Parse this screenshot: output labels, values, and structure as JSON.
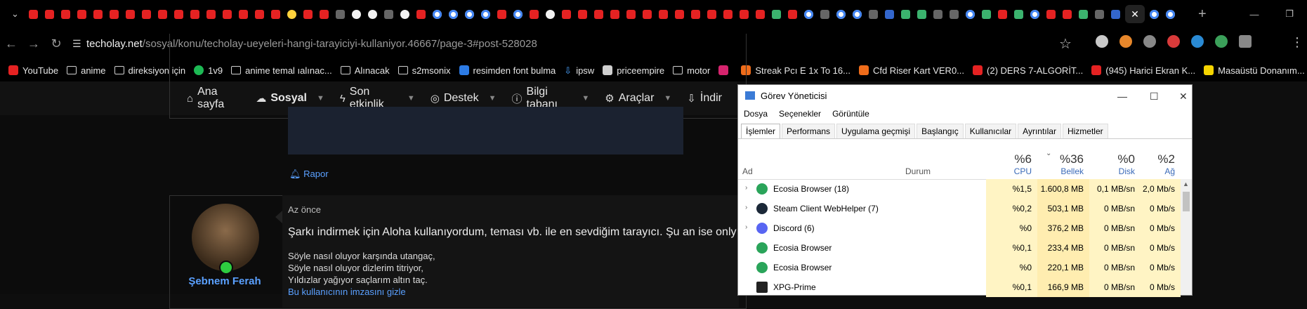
{
  "tabs": {
    "favicons": [
      "yt",
      "yt",
      "yt",
      "yt",
      "yt",
      "yt",
      "yt",
      "yt",
      "yt",
      "yt",
      "yt",
      "yt",
      "yt",
      "yt",
      "yt",
      "yt",
      "ok",
      "yt",
      "yt",
      "tc",
      "gh",
      "gh",
      "tc",
      "gh",
      "yt",
      "g",
      "g",
      "g",
      "g",
      "yt",
      "g",
      "yt",
      "gh",
      "yt",
      "yt",
      "yt",
      "yt",
      "yt",
      "yt",
      "yt",
      "yt",
      "yt",
      "yt",
      "yt",
      "yt",
      "yt",
      "grn",
      "yt",
      "g",
      "tc",
      "g",
      "g",
      "tc",
      "bl",
      "grn",
      "grn",
      "tc",
      "tc",
      "g",
      "grn",
      "yt",
      "grn",
      "g",
      "yt",
      "yt",
      "grn",
      "tc",
      "bl",
      "active",
      "g",
      "g"
    ],
    "new_tab": "+"
  },
  "window": {
    "minimize": "—",
    "restore": "❐",
    "close": "✕"
  },
  "address_bar": {
    "host": "techolay.net",
    "path": "/sosyal/konu/techolay-ueyeleri-hangi-tarayiciyi-kullaniyor.46667/page-3#post-528028"
  },
  "bookmarks": [
    {
      "icon": "yt",
      "label": "YouTube"
    },
    {
      "icon": "folder",
      "label": "anime"
    },
    {
      "icon": "folder",
      "label": "direksiyon için"
    },
    {
      "icon": "sp",
      "label": "1v9"
    },
    {
      "icon": "folder",
      "label": "anime temal ıalınac..."
    },
    {
      "icon": "folder",
      "label": "Alınacak"
    },
    {
      "icon": "folder",
      "label": "s2msonix"
    },
    {
      "icon": "blue",
      "label": "resimden font bulma"
    },
    {
      "icon": "dl",
      "label": "ipsw"
    },
    {
      "icon": "pe",
      "label": "priceempire"
    },
    {
      "icon": "folder",
      "label": "motor"
    },
    {
      "icon": "ig",
      "label": ""
    },
    {
      "icon": "hb",
      "label": "Streak Pcı E 1x To 16..."
    },
    {
      "icon": "hb",
      "label": "Cfd Riser Kart VER0..."
    },
    {
      "icon": "yt",
      "label": "(2) DERS 7-ALGORİT..."
    },
    {
      "icon": "yt",
      "label": "(945) Harici Ekran K..."
    },
    {
      "icon": "s",
      "label": "Masaüstü Donanım..."
    }
  ],
  "forum_nav": [
    {
      "icon": "⌂",
      "label": "Ana sayfa",
      "bold": false,
      "caret": false
    },
    {
      "icon": "☁",
      "label": "Sosyal",
      "bold": true,
      "caret": true
    },
    {
      "icon": "ϟ",
      "label": "Son etkinlik",
      "bold": false,
      "caret": true
    },
    {
      "icon": "◎",
      "label": "Destek",
      "bold": false,
      "caret": true
    },
    {
      "icon": "ⓘ",
      "label": "Bilgi tabanı",
      "bold": false,
      "caret": true
    },
    {
      "icon": "⚙",
      "label": "Araçlar",
      "bold": false,
      "caret": true
    },
    {
      "icon": "⇩",
      "label": "İndir",
      "bold": false,
      "caret": false
    }
  ],
  "post1": {
    "report": "Rapor"
  },
  "post2": {
    "time": "Az önce",
    "text": "Şarkı indirmek için Aloha kullanıyordum, teması vb. ile en sevdiğim tarayıcı. Şu an ise only Chrom",
    "signature": [
      "Söyle nasıl oluyor karşında utangaç,",
      "Söyle nasıl oluyor dizlerim titriyor,",
      "Yıldızlar yağıyor saçlarım altın taç."
    ],
    "signature_link": "Bu kullanıcının imzasını gizle",
    "username": "Şebnem Ferah"
  },
  "task_manager": {
    "title": "Görev Yöneticisi",
    "menu": [
      "Dosya",
      "Seçenekler",
      "Görüntüle"
    ],
    "tabs": [
      "İşlemler",
      "Performans",
      "Uygulama geçmişi",
      "Başlangıç",
      "Kullanıcılar",
      "Ayrıntılar",
      "Hizmetler"
    ],
    "columns": {
      "name": "Ad",
      "status": "Durum",
      "cpu": {
        "pct": "%6",
        "label": "CPU"
      },
      "mem": {
        "pct": "%36",
        "label": "Bellek"
      },
      "disk": {
        "pct": "%0",
        "label": "Disk"
      },
      "net": {
        "pct": "%2",
        "label": "Ağ"
      }
    },
    "rows": [
      {
        "icon": "eco",
        "expand": true,
        "name": "Ecosia Browser (18)",
        "cpu": "%1,5",
        "mem": "1.600,8 MB",
        "disk": "0,1 MB/sn",
        "net": "2,0 Mb/s"
      },
      {
        "icon": "steam",
        "expand": true,
        "name": "Steam Client WebHelper (7)",
        "cpu": "%0,2",
        "mem": "503,1 MB",
        "disk": "0 MB/sn",
        "net": "0 Mb/s"
      },
      {
        "icon": "disc",
        "expand": true,
        "name": "Discord (6)",
        "cpu": "%0",
        "mem": "376,2 MB",
        "disk": "0 MB/sn",
        "net": "0 Mb/s"
      },
      {
        "icon": "eco",
        "expand": false,
        "name": "Ecosia Browser",
        "cpu": "%0,1",
        "mem": "233,4 MB",
        "disk": "0 MB/sn",
        "net": "0 Mb/s"
      },
      {
        "icon": "eco",
        "expand": false,
        "name": "Ecosia Browser",
        "cpu": "%0",
        "mem": "220,1 MB",
        "disk": "0 MB/sn",
        "net": "0 Mb/s"
      },
      {
        "icon": "xpg",
        "expand": false,
        "name": "XPG-Prime",
        "cpu": "%0,1",
        "mem": "166,9 MB",
        "disk": "0 MB/sn",
        "net": "0 Mb/s"
      }
    ]
  }
}
